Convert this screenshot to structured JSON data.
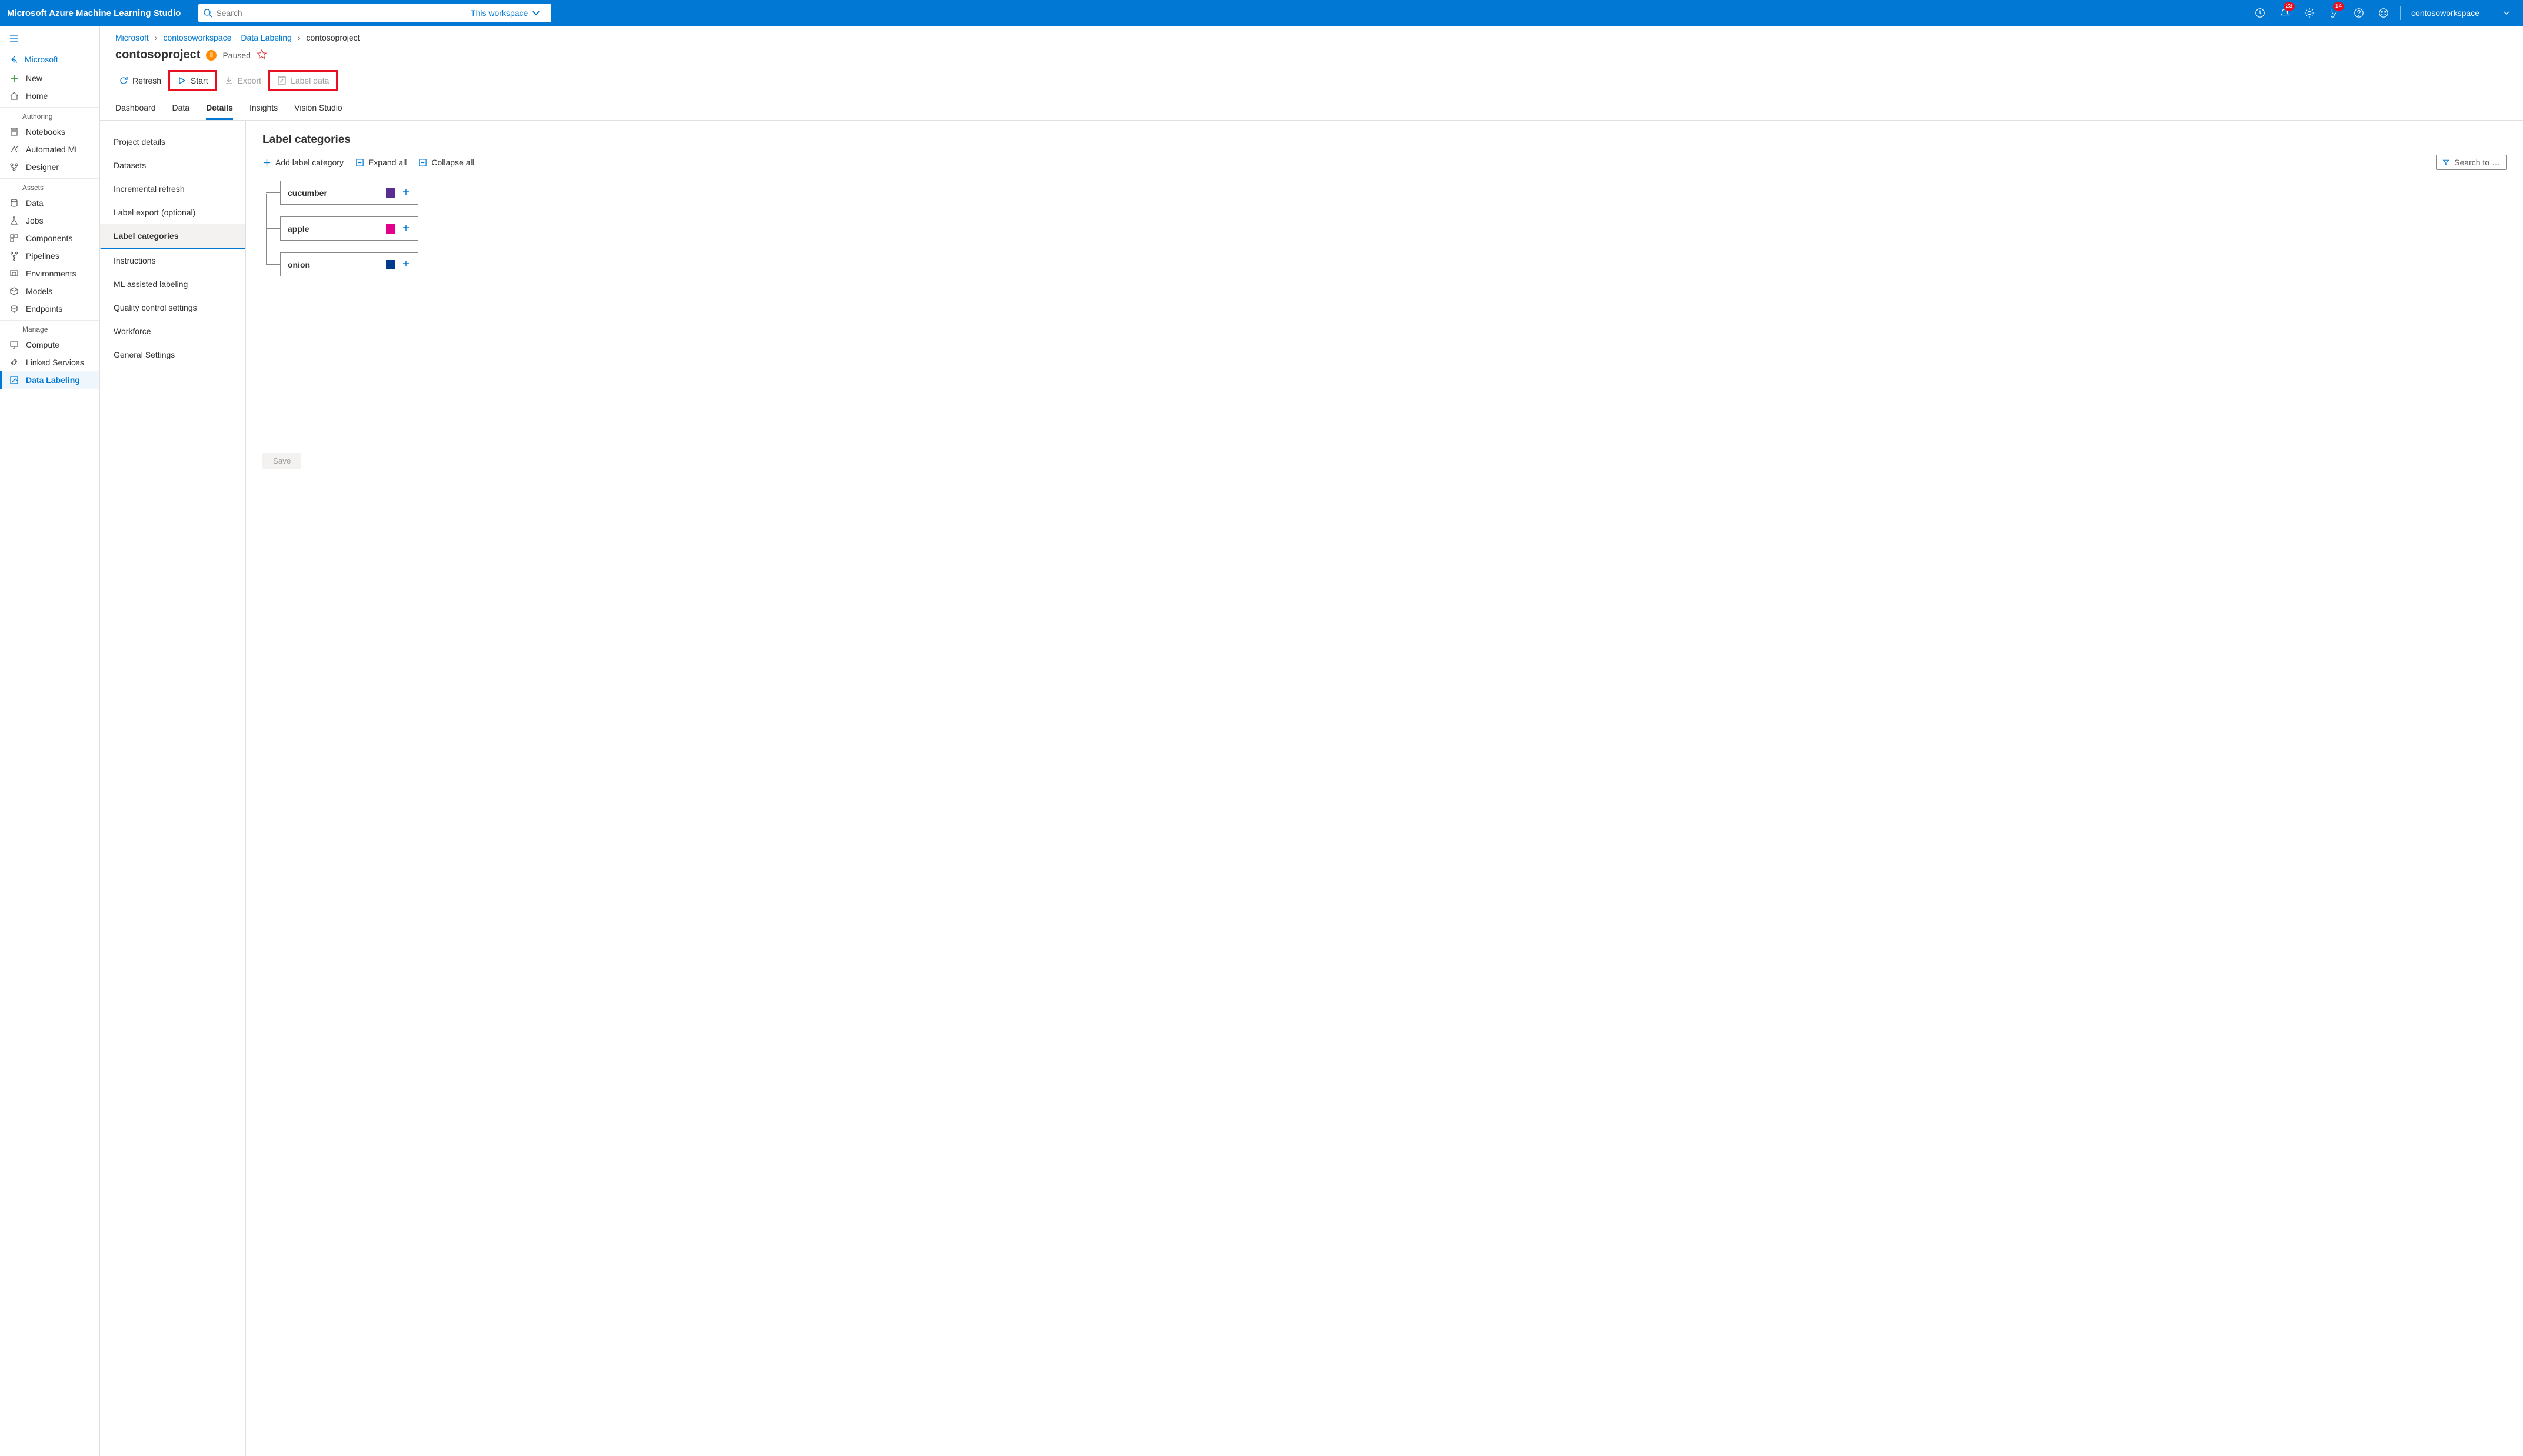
{
  "header": {
    "productTitle": "Microsoft Azure Machine Learning Studio",
    "searchPlaceholder": "Search",
    "scopeLabel": "This workspace",
    "notifBadge": "23",
    "diagBadge": "14",
    "workspace": "contosoworkspace"
  },
  "leftnav": {
    "backLabel": "Microsoft",
    "new": "New",
    "home": "Home",
    "groups": {
      "authoring": "Authoring",
      "assets": "Assets",
      "manage": "Manage"
    },
    "items": {
      "notebooks": "Notebooks",
      "automl": "Automated ML",
      "designer": "Designer",
      "data": "Data",
      "jobs": "Jobs",
      "components": "Components",
      "pipelines": "Pipelines",
      "environments": "Environments",
      "models": "Models",
      "endpoints": "Endpoints",
      "compute": "Compute",
      "linked": "Linked Services",
      "labeling": "Data Labeling"
    }
  },
  "crumbs": {
    "c1": "Microsoft",
    "c2": "contosoworkspace",
    "c3": "Data Labeling",
    "c4": "contosoproject"
  },
  "title": {
    "name": "contosoproject",
    "status": "Paused"
  },
  "toolbar": {
    "refresh": "Refresh",
    "start": "Start",
    "export": "Export",
    "labelData": "Label data"
  },
  "tabs": {
    "dashboard": "Dashboard",
    "data": "Data",
    "details": "Details",
    "insights": "Insights",
    "vision": "Vision Studio"
  },
  "subnav": {
    "projectDetails": "Project details",
    "datasets": "Datasets",
    "incremental": "Incremental refresh",
    "labelExport": "Label export (optional)",
    "labelCategories": "Label categories",
    "instructions": "Instructions",
    "mlAssist": "ML assisted labeling",
    "quality": "Quality control settings",
    "workforce": "Workforce",
    "general": "General Settings"
  },
  "pane": {
    "heading": "Label categories",
    "addCategory": "Add label category",
    "expandAll": "Expand all",
    "collapseAll": "Collapse all",
    "searchPlaceholder": "Search to …",
    "labels": [
      {
        "name": "cucumber",
        "color": "#5c2d91"
      },
      {
        "name": "apple",
        "color": "#e3008c"
      },
      {
        "name": "onion",
        "color": "#003a8c"
      }
    ],
    "save": "Save"
  }
}
